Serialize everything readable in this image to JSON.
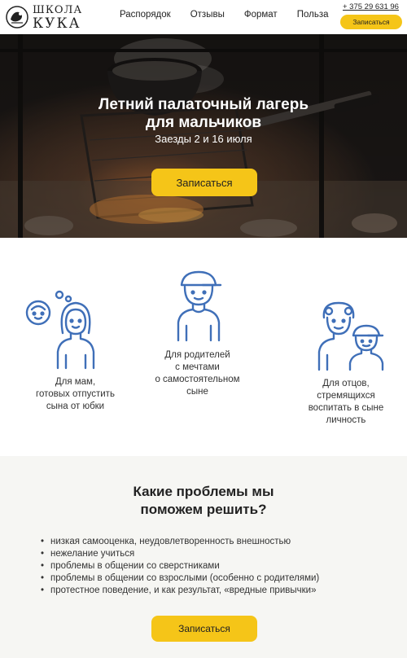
{
  "header": {
    "logo_line1": "ШКОЛА",
    "logo_line2": "КУКА",
    "nav": [
      "Распорядок",
      "Отзывы",
      "Формат",
      "Польза"
    ],
    "phone": "+ 375 29 631 96",
    "cta_label": "Записаться"
  },
  "hero": {
    "title_line1": "Летний палаточный лагерь",
    "title_line2": "для мальчиков",
    "subtitle": "Заезды 2 и 16 июля",
    "cta_label": "Записаться"
  },
  "audience": {
    "items": [
      {
        "text_lines": [
          "Для мам,",
          "готовых отпустить",
          "сына от юбки"
        ],
        "icon": "mother-child-icon"
      },
      {
        "text_lines": [
          "Для родителей",
          "с мечтами",
          "о самостоятельном",
          "сыне"
        ],
        "icon": "boy-icon"
      },
      {
        "text_lines": [
          "Для отцов,",
          "стремящихся",
          "воспитать в сыне",
          "личность"
        ],
        "icon": "grandfather-boy-icon"
      }
    ],
    "accent_color": "#3f6fb8"
  },
  "problems": {
    "title_line1": "Какие проблемы мы",
    "title_line2": "поможем решить?",
    "items": [
      "низкая самооценка, неудовлетворенность внешностью",
      "нежелание учиться",
      "проблемы в общении со сверстниками",
      "проблемы в общении со взрослыми (особенно с родителями)",
      "протестное поведение, и как результат, «вредные привычки»"
    ],
    "cta_label": "Записаться"
  },
  "colors": {
    "accent_yellow": "#f5c518",
    "icon_blue": "#3f6fb8",
    "problems_bg": "#f6f6f3"
  }
}
